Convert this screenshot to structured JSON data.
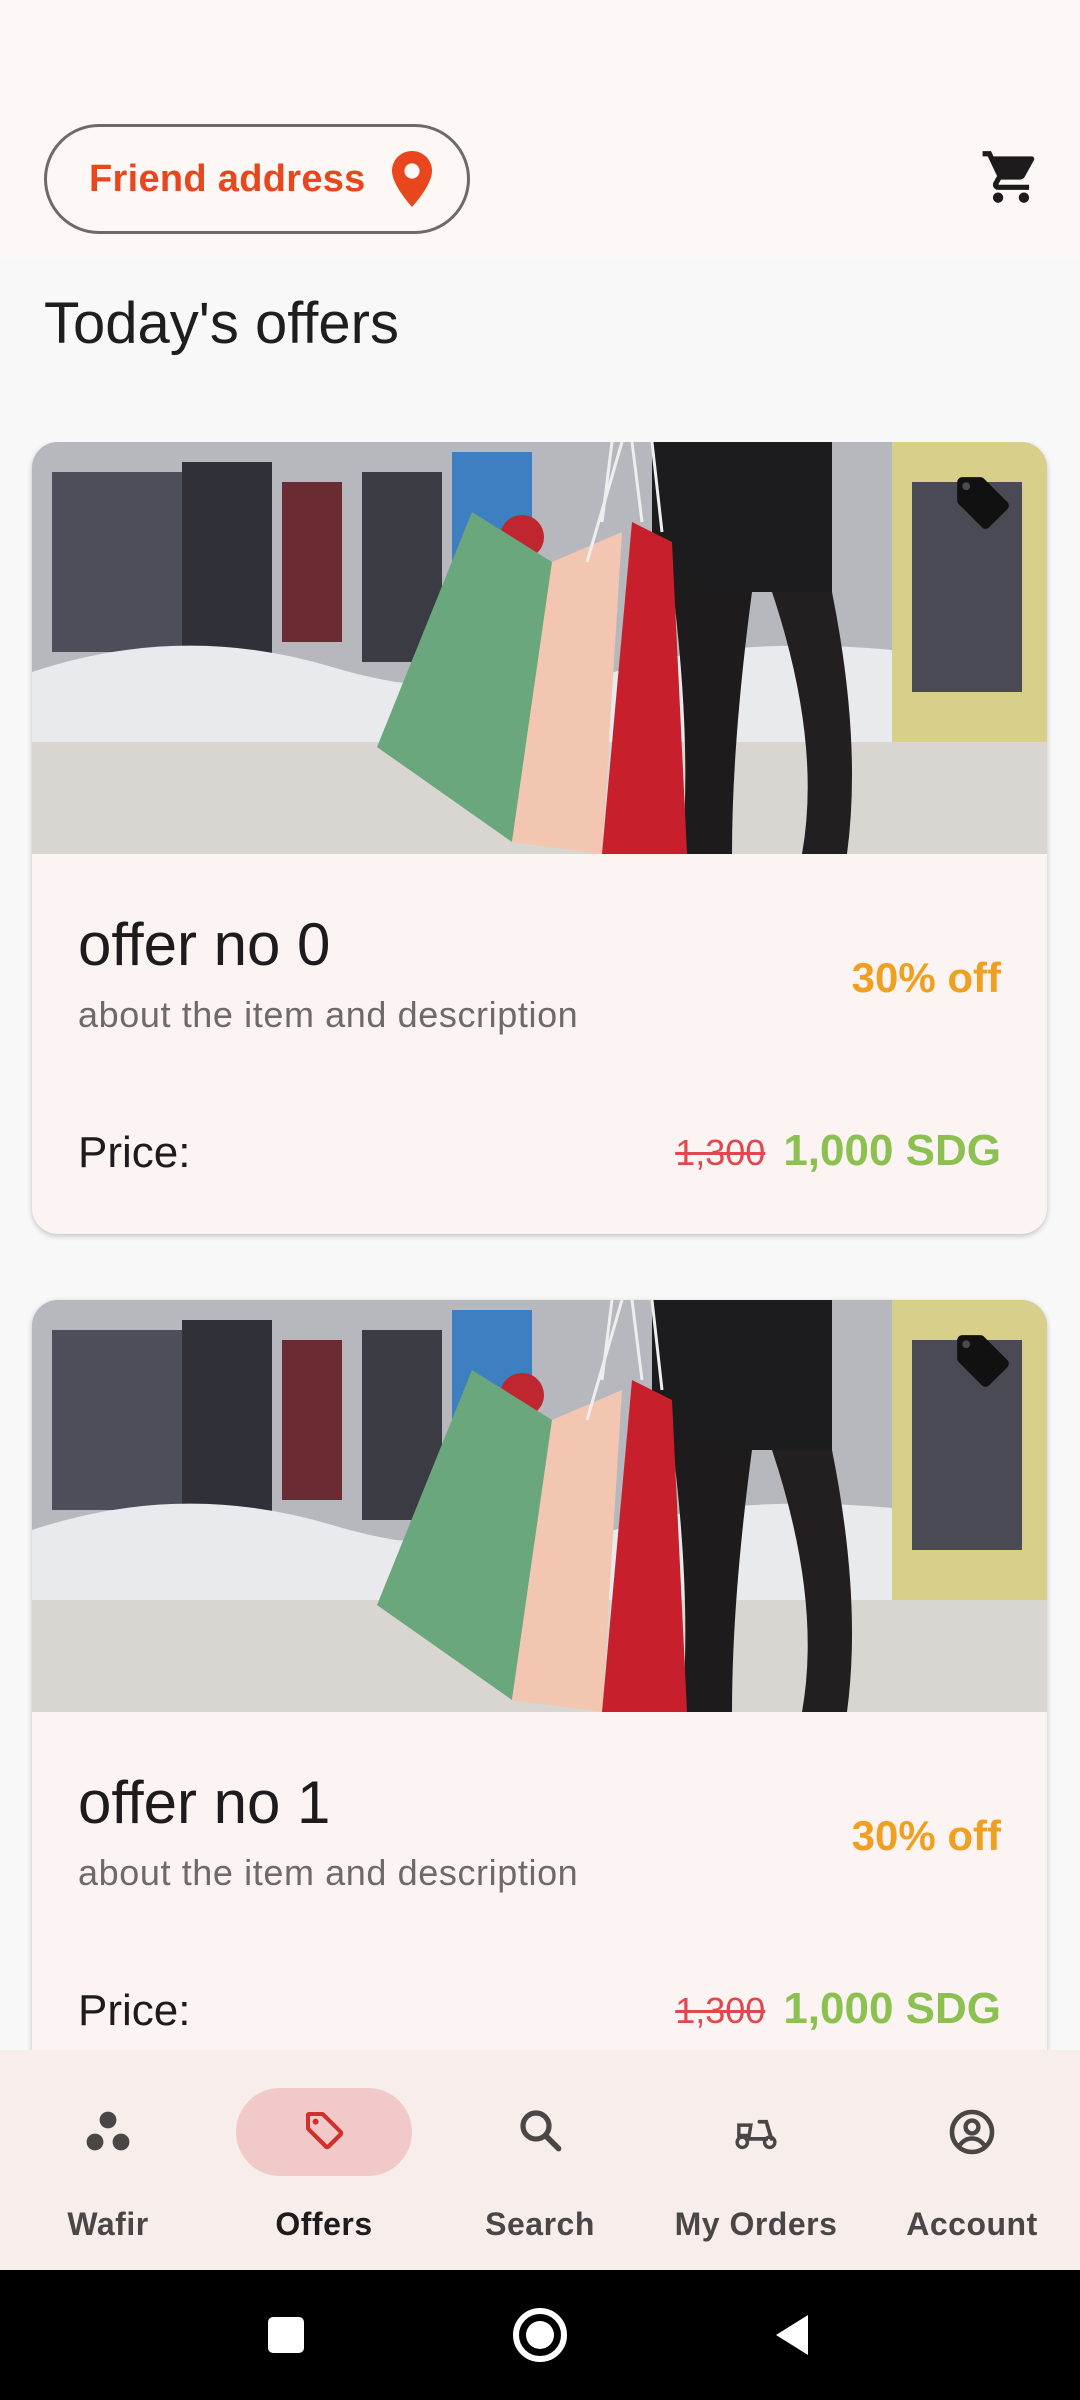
{
  "header": {
    "address_label": "Friend address",
    "address_icon": "location-pin-icon",
    "cart_icon": "shopping-cart-icon",
    "accent_color": "#e8461c"
  },
  "section_title": "Today's offers",
  "offers": [
    {
      "title": "offer no 0",
      "description": "about the item and description",
      "discount": "30% off",
      "price_label": "Price:",
      "old_price": "1,300",
      "new_price": "1,000 SDG",
      "tag_icon": "price-tag-icon"
    },
    {
      "title": "offer no 1",
      "description": "about the item and description",
      "discount": "30% off",
      "price_label": "Price:",
      "old_price": "1,300",
      "new_price": "1,000 SDG",
      "tag_icon": "price-tag-icon"
    }
  ],
  "colors": {
    "discount": "#f0a020",
    "old_price": "#e0474f",
    "new_price": "#8cc152",
    "nav_indicator": "#f0c9c8"
  },
  "bottom_nav": {
    "active": "Offers",
    "items": [
      {
        "label": "Wafir",
        "icon": "dots-cluster-icon"
      },
      {
        "label": "Offers",
        "icon": "tag-icon"
      },
      {
        "label": "Search",
        "icon": "search-icon"
      },
      {
        "label": "My Orders",
        "icon": "scooter-icon"
      },
      {
        "label": "Account",
        "icon": "account-circle-icon"
      }
    ]
  },
  "system_nav": [
    "recents-square-icon",
    "home-circle-icon",
    "back-triangle-icon"
  ]
}
